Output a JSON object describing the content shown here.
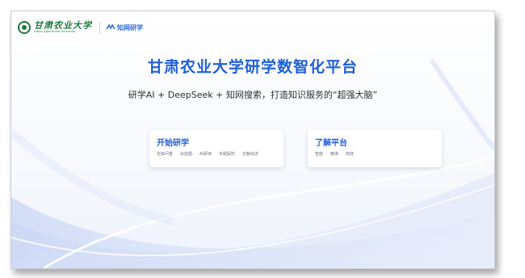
{
  "header": {
    "university_name": "甘肃农业大学",
    "university_name_en": "Gansu Agricultural University",
    "brand_name": "知网研学"
  },
  "main": {
    "title": "甘肃农业大学研学数智化平台",
    "subtitle": "研学AI + DeepSeek + 知网搜索，打造知识服务的“超强大脑”"
  },
  "cards": [
    {
      "title": "开始研学",
      "tags": [
        "全库问答",
        "AI选题",
        "AI研读",
        "专题探究",
        "文献综述"
      ]
    },
    {
      "title": "了解平台",
      "tags": [
        "智能",
        "精准",
        "高效"
      ]
    }
  ],
  "colors": {
    "accent": "#1f5fd6",
    "brand_green": "#1e7a3c"
  }
}
